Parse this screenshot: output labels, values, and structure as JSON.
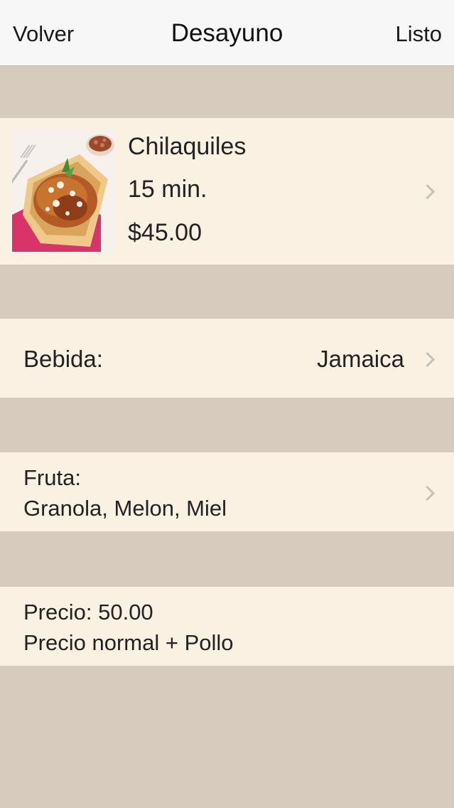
{
  "nav": {
    "back_label": "Volver",
    "title": "Desayuno",
    "done_label": "Listo"
  },
  "dish": {
    "name": "Chilaquiles",
    "time": "15 min.",
    "price": "$45.00",
    "image": "chilaquiles-photo"
  },
  "bebida": {
    "label": "Bebida:",
    "value": "Jamaica"
  },
  "fruta": {
    "label": "Fruta:",
    "value": "Granola, Melon, Miel"
  },
  "precio": {
    "line1": "Precio: 50.00",
    "line2": "Precio normal + Pollo"
  },
  "colors": {
    "background": "#d6cbbd",
    "cell": "#fbf1e2",
    "navbar": "#f7f7f7",
    "chevron": "#c4c0bb"
  },
  "icons": {
    "disclosure": "chevron-right-icon"
  }
}
